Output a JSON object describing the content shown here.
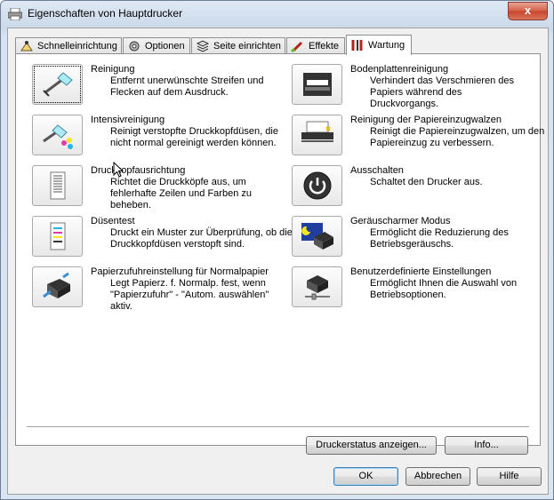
{
  "window": {
    "title": "Eigenschaften von Hauptdrucker",
    "close_label": "x"
  },
  "tabs": [
    {
      "label": "Schnelleinrichtung",
      "icon": "quick-setup-icon"
    },
    {
      "label": "Optionen",
      "icon": "options-gear-icon"
    },
    {
      "label": "Seite einrichten",
      "icon": "page-setup-icon"
    },
    {
      "label": "Effekte",
      "icon": "effects-brush-icon"
    },
    {
      "label": "Wartung",
      "icon": "maintenance-tools-icon",
      "active": true
    }
  ],
  "left_items": [
    {
      "title": "Reinigung",
      "desc": "Entfernt unerwünschte Streifen und Flecken auf dem Ausdruck.",
      "icon": "cleaning-brush-icon"
    },
    {
      "title": "Intensivreinigung",
      "desc": "Reinigt verstopfte Druckkopfdüsen, die nicht normal gereinigt werden können.",
      "icon": "deep-cleaning-icon"
    },
    {
      "title": "Druckkopfausrichtung",
      "desc": "Richtet die Druckköpfe aus, um fehlerhafte Zeilen und Farben zu beheben.",
      "icon": "print-head-alignment-icon"
    },
    {
      "title": "Düsentest",
      "desc": "Druckt ein Muster zur Überprüfung, ob die Druckkopfdüsen verstopft sind.",
      "icon": "nozzle-check-icon"
    },
    {
      "title": "Papierzufuhreinstellung für Normalpapier",
      "desc": "Legt Papierz. f. Normalp. fest, wenn \"Papierzufuhr\" - \"Autom. auswählen\" aktiv.",
      "icon": "paper-feed-setting-icon"
    }
  ],
  "right_items": [
    {
      "title": "Bodenplattenreinigung",
      "desc": "Verhindert das Verschmieren des Papiers während des Druckvorgangs.",
      "icon": "bottom-plate-cleaning-icon"
    },
    {
      "title": "Reinigung der Papiereinzugwalzen",
      "desc": "Reinigt die Papiereinzugwalzen, um den Papiereinzug zu verbessern.",
      "icon": "roller-cleaning-icon"
    },
    {
      "title": "Ausschalten",
      "desc": "Schaltet den Drucker aus.",
      "icon": "power-icon"
    },
    {
      "title": "Geräuscharmer Modus",
      "desc": "Ermöglicht die Reduzierung des Betriebsgeräuschs.",
      "icon": "quiet-mode-icon"
    },
    {
      "title": "Benutzerdefinierte Einstellungen",
      "desc": "Ermöglicht Ihnen die Auswahl von Betriebsoptionen.",
      "icon": "custom-settings-icon"
    }
  ],
  "buttons": {
    "status": "Druckerstatus anzeigen...",
    "info": "Info...",
    "ok": "OK",
    "cancel": "Abbrechen",
    "help": "Hilfe"
  }
}
